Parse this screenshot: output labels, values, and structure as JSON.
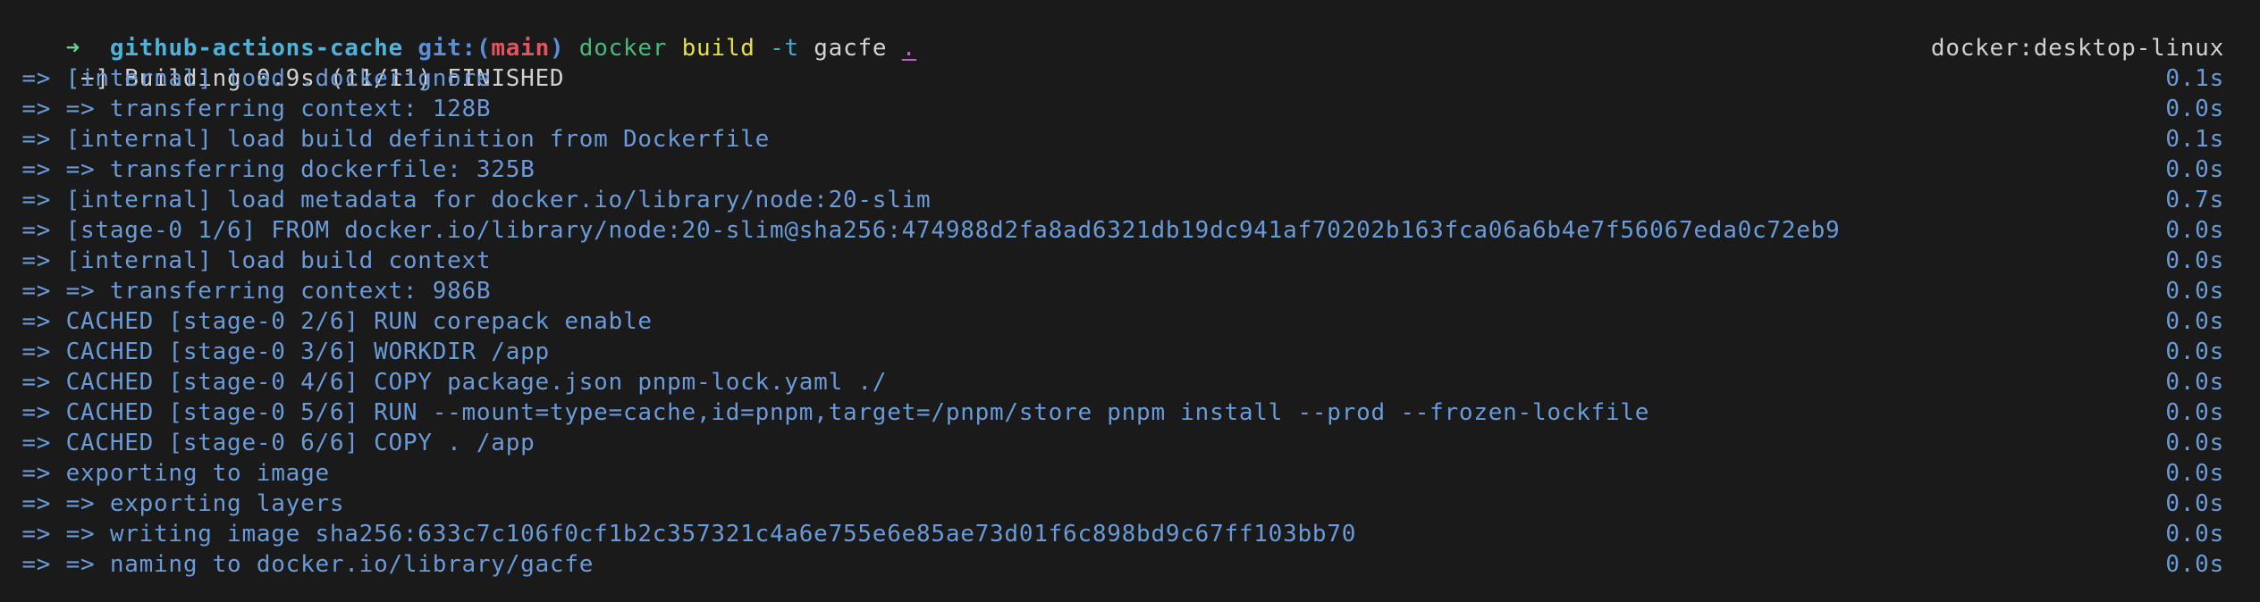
{
  "prompt": {
    "arrow": "➜",
    "directory": "github-actions-cache",
    "git_label": "git:(",
    "branch": "main",
    "git_close": ")",
    "command": {
      "program": "docker",
      "subcommand": "build",
      "flag": "-t",
      "tag": "gacfe",
      "context": "."
    }
  },
  "build_header": {
    "status": "[+] Building 0.9s (11/11) FINISHED",
    "builder": "docker:desktop-linux"
  },
  "steps": [
    {
      "text": " => [internal] load .dockerignore",
      "time": "0.1s"
    },
    {
      "text": " => => transferring context: 128B",
      "time": "0.0s"
    },
    {
      "text": " => [internal] load build definition from Dockerfile",
      "time": "0.1s"
    },
    {
      "text": " => => transferring dockerfile: 325B",
      "time": "0.0s"
    },
    {
      "text": " => [internal] load metadata for docker.io/library/node:20-slim",
      "time": "0.7s"
    },
    {
      "text": " => [stage-0 1/6] FROM docker.io/library/node:20-slim@sha256:474988d2fa8ad6321db19dc941af70202b163fca06a6b4e7f56067eda0c72eb9",
      "time": "0.0s"
    },
    {
      "text": " => [internal] load build context",
      "time": "0.0s"
    },
    {
      "text": " => => transferring context: 986B",
      "time": "0.0s"
    },
    {
      "text": " => CACHED [stage-0 2/6] RUN corepack enable",
      "time": "0.0s"
    },
    {
      "text": " => CACHED [stage-0 3/6] WORKDIR /app",
      "time": "0.0s"
    },
    {
      "text": " => CACHED [stage-0 4/6] COPY package.json pnpm-lock.yaml ./",
      "time": "0.0s"
    },
    {
      "text": " => CACHED [stage-0 5/6] RUN --mount=type=cache,id=pnpm,target=/pnpm/store pnpm install --prod --frozen-lockfile",
      "time": "0.0s"
    },
    {
      "text": " => CACHED [stage-0 6/6] COPY . /app",
      "time": "0.0s"
    },
    {
      "text": " => exporting to image",
      "time": "0.0s"
    },
    {
      "text": " => => exporting layers",
      "time": "0.0s"
    },
    {
      "text": " => => writing image sha256:633c7c106f0cf1b2c357321c4a6e755e6e85ae73d01f6c898bd9c67ff103bb70",
      "time": "0.0s"
    },
    {
      "text": " => => naming to docker.io/library/gacfe",
      "time": "0.0s"
    }
  ],
  "colors": {
    "background": "#1a1a1a",
    "step_text": "#6a9bd8",
    "branch": "#e05561",
    "directory": "#4fb3d9"
  }
}
